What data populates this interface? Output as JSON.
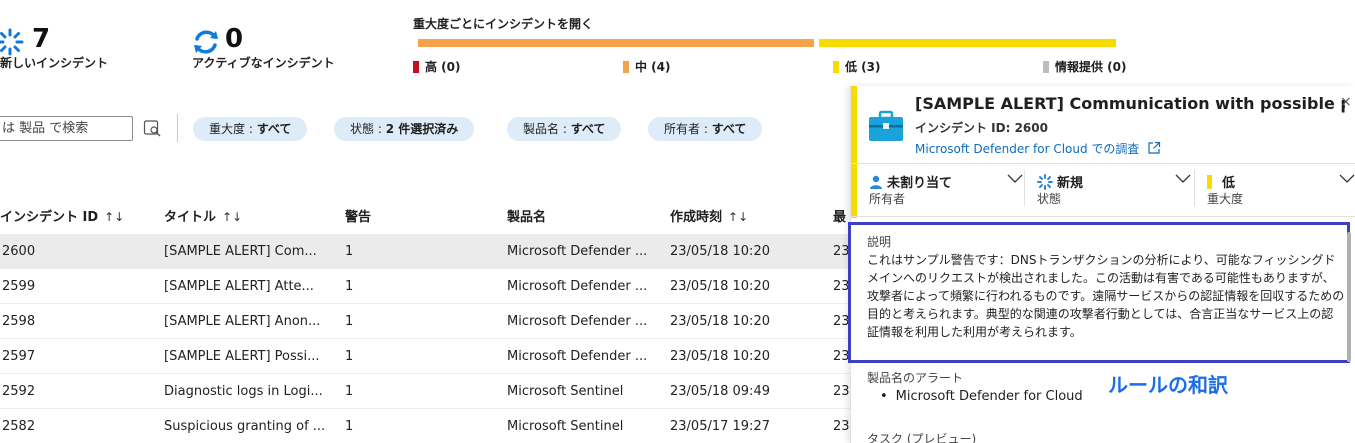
{
  "stats": {
    "new": {
      "value": "7",
      "label": "新しいインシデント"
    },
    "active": {
      "value": "0",
      "label": "アクティブなインシデント"
    }
  },
  "severity": {
    "title": "重大度ごとにインシデントを開く",
    "legend": [
      {
        "label": "高 (0)",
        "color": "#c50f1f"
      },
      {
        "label": "中 (4)",
        "color": "#f7a24b"
      },
      {
        "label": "低 (3)",
        "color": "#f8dc00"
      },
      {
        "label": "情報提供 (0)",
        "color": "#bdbdbd"
      }
    ]
  },
  "filters": {
    "search_text": "は 製品 で検索",
    "pills": [
      {
        "key": "重大度 : ",
        "value": "すべて"
      },
      {
        "key": "状態 : ",
        "value": "2 件選択済み"
      },
      {
        "key": "製品名 : ",
        "value": "すべて"
      },
      {
        "key": "所有者 : ",
        "value": "すべて"
      }
    ]
  },
  "table": {
    "headers": [
      {
        "label": "インシデント ID",
        "sort": "↑↓"
      },
      {
        "label": "タイトル",
        "sort": "↑↓"
      },
      {
        "label": "警告",
        "sort": ""
      },
      {
        "label": "製品名",
        "sort": ""
      },
      {
        "label": "作成時刻",
        "sort": "↑↓"
      },
      {
        "label": "最",
        "sort": ""
      }
    ],
    "rows": [
      {
        "id": "2600",
        "title": "[SAMPLE ALERT] Com...",
        "alerts": "1",
        "product": "Microsoft Defender ...",
        "created": "23/05/18 10:20",
        "last": "23",
        "selected": true
      },
      {
        "id": "2599",
        "title": "[SAMPLE ALERT] Atte...",
        "alerts": "1",
        "product": "Microsoft Defender ...",
        "created": "23/05/18 10:20",
        "last": "23",
        "selected": false
      },
      {
        "id": "2598",
        "title": "[SAMPLE ALERT] Anon...",
        "alerts": "1",
        "product": "Microsoft Defender ...",
        "created": "23/05/18 10:20",
        "last": "23",
        "selected": false
      },
      {
        "id": "2597",
        "title": "[SAMPLE ALERT] Possi...",
        "alerts": "1",
        "product": "Microsoft Defender ...",
        "created": "23/05/18 10:20",
        "last": "23",
        "selected": false
      },
      {
        "id": "2592",
        "title": "Diagnostic logs in Logi...",
        "alerts": "1",
        "product": "Microsoft Sentinel",
        "created": "23/05/18 09:49",
        "last": "23",
        "selected": false
      },
      {
        "id": "2582",
        "title": "Suspicious granting of ...",
        "alerts": "1",
        "product": "Microsoft Sentinel",
        "created": "23/05/17 19:27",
        "last": "23",
        "selected": false
      }
    ]
  },
  "panel": {
    "title": "[SAMPLE ALERT] Communication with possible phish...",
    "close": "×",
    "incident_id": "インシデント ID: 2600",
    "link": "Microsoft Defender for Cloud での調査",
    "owner": {
      "value": "未割り当て",
      "label": "所有者"
    },
    "status": {
      "value": "新規",
      "label": "状態"
    },
    "severity": {
      "value": "低",
      "label": "重大度"
    },
    "description_heading": "説明",
    "description": "これはサンプル警告です：DNSトランザクションの分析により、可能なフィッシングドメインへのリクエストが検出されました。この活動は有害である可能性もありますが、攻撃者によって頻繁に行われるものです。遠隔サービスからの認証情報を回収するための目的と考えられます。典型的な関連の攻撃者行動としては、合言正当なサービス上の認証情報を利用した利用が考えられます。",
    "translation_note": "ルールの和訳",
    "product_alerts_heading": "製品名のアラート",
    "product_alerts": [
      "Microsoft Defender for Cloud"
    ],
    "tasks_heading": "タスク (プレビュー)"
  }
}
